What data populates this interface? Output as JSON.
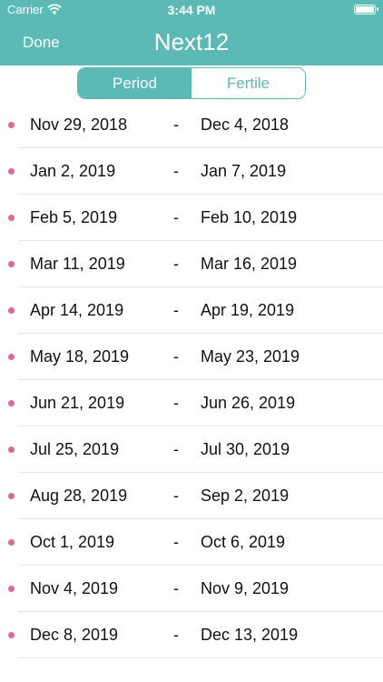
{
  "status_bar": {
    "carrier": "Carrier",
    "time": "3:44 PM"
  },
  "nav": {
    "done_label": "Done",
    "title": "Next12"
  },
  "segment": {
    "options": [
      "Period",
      "Fertile"
    ],
    "selected": "Period"
  },
  "separator": "-",
  "periods": [
    {
      "start": "Nov 29, 2018",
      "end": "Dec 4, 2018"
    },
    {
      "start": "Jan 2, 2019",
      "end": "Jan 7, 2019"
    },
    {
      "start": "Feb 5, 2019",
      "end": "Feb 10, 2019"
    },
    {
      "start": "Mar 11, 2019",
      "end": "Mar 16, 2019"
    },
    {
      "start": "Apr 14, 2019",
      "end": "Apr 19, 2019"
    },
    {
      "start": "May 18, 2019",
      "end": "May 23, 2019"
    },
    {
      "start": "Jun 21, 2019",
      "end": "Jun 26, 2019"
    },
    {
      "start": "Jul 25, 2019",
      "end": "Jul 30, 2019"
    },
    {
      "start": "Aug 28, 2019",
      "end": "Sep 2, 2019"
    },
    {
      "start": "Oct 1, 2019",
      "end": "Oct 6, 2019"
    },
    {
      "start": "Nov 4, 2019",
      "end": "Nov 9, 2019"
    },
    {
      "start": "Dec 8, 2019",
      "end": "Dec 13, 2019"
    }
  ],
  "colors": {
    "accent": "#5bbab6",
    "dot": "#e0678e"
  }
}
